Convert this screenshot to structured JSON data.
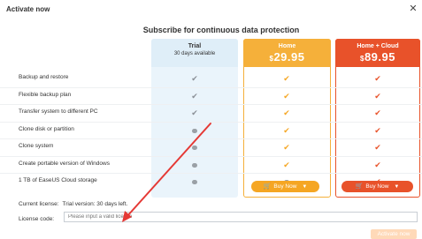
{
  "window": {
    "title": "Activate now",
    "close_icon": "close-icon"
  },
  "subhead": "Subscribe for continuous data protection",
  "plans": {
    "trial": {
      "name": "Trial",
      "sub": "30 days available"
    },
    "home": {
      "name": "Home",
      "currency": "$",
      "price": "29.95",
      "buy_label": "Buy Now"
    },
    "cloud": {
      "name": "Home + Cloud",
      "currency": "$",
      "price": "89.95",
      "buy_label": "Buy Now"
    }
  },
  "features": [
    {
      "label": "Backup and restore",
      "trial": "check",
      "home": "check",
      "cloud": "check"
    },
    {
      "label": "Flexible backup plan",
      "trial": "check",
      "home": "check",
      "cloud": "check"
    },
    {
      "label": "Transfer system to different PC",
      "trial": "check",
      "home": "check",
      "cloud": "check"
    },
    {
      "label": "Clone disk or partition",
      "trial": "dot",
      "home": "check",
      "cloud": "check"
    },
    {
      "label": "Clone system",
      "trial": "dot",
      "home": "check",
      "cloud": "check"
    },
    {
      "label": "Create portable version of Windows",
      "trial": "dot",
      "home": "check",
      "cloud": "check"
    },
    {
      "label": "1 TB of EaseUS Cloud storage",
      "trial": "dot",
      "home": "dot",
      "cloud": "check"
    }
  ],
  "license": {
    "current_label": "Current license:",
    "current_value": "Trial version: 30 days left.",
    "code_label": "License code:",
    "code_placeholder": "Please input a valid license",
    "code_value": "",
    "activate_label": "Activate now"
  },
  "colors": {
    "home_accent": "#f5a623",
    "cloud_accent": "#e8522a",
    "trial_bg": "#eaf4fb",
    "annotation_arrow": "#e53935"
  }
}
